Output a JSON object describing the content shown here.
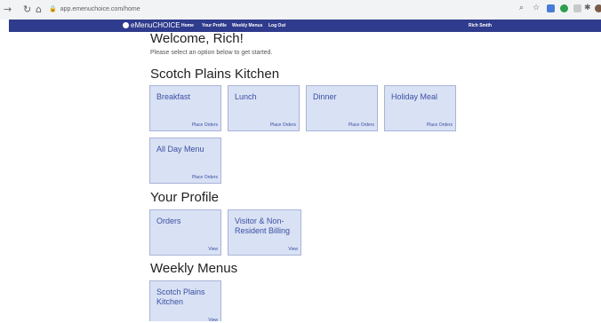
{
  "browser": {
    "url": "app.emenuchoice.com/home",
    "back_glyph": "→",
    "reload_glyph": "↻",
    "home_glyph": "⌂",
    "lock_glyph": "🔒"
  },
  "app": {
    "brand": "eMenuCHOICE",
    "nav": [
      "Home",
      "Your Profile",
      "Weekly Menus",
      "Log Out"
    ],
    "user": "Rich Smith"
  },
  "welcome": {
    "heading": "Welcome, Rich!",
    "subtitle": "Please select an option below to get started."
  },
  "sections": [
    {
      "title": "Scotch Plains Kitchen",
      "cards": [
        {
          "title": "Breakfast",
          "action": "Place Orders"
        },
        {
          "title": "Lunch",
          "action": "Place Orders"
        },
        {
          "title": "Dinner",
          "action": "Place Orders"
        },
        {
          "title": "Holiday Meal",
          "action": "Place Orders"
        },
        {
          "title": "All Day Menu",
          "action": "Place Orders"
        }
      ]
    },
    {
      "title": "Your Profile",
      "cards": [
        {
          "title": "Orders",
          "action": "View"
        },
        {
          "title": "Visitor & Non-Resident Billing",
          "action": "View"
        }
      ]
    },
    {
      "title": "Weekly Menus",
      "cards": [
        {
          "title": "Scotch Plains Kitchen",
          "action": "View"
        }
      ]
    }
  ],
  "colors": {
    "navbar": "#2f3b8c",
    "card_bg": "#d9e1f5",
    "card_text": "#3a4fa0"
  }
}
